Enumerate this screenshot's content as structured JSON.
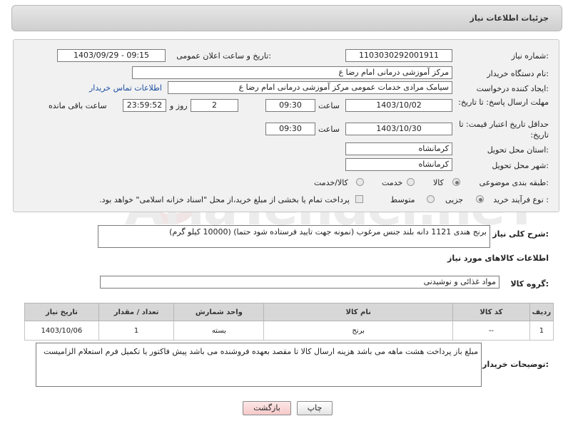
{
  "header": {
    "title": "جزئیات اطلاعات نیاز"
  },
  "watermark": "AriaTender.neT",
  "form": {
    "need_number_label": "شماره نیاز:",
    "need_number": "1103030292001911",
    "announce_label": "تاریخ و ساعت اعلان عمومی:",
    "announce_value": "1403/09/29 - 09:15",
    "buyer_org_label": "نام دستگاه خریدار:",
    "buyer_org": "مرکز آموزشی  درمانی امام رضا  ع",
    "requester_label": "ایجاد کننده درخواست:",
    "requester": "سیامک مرادی خدمات عمومی مرکز آموزشی  درمانی امام رضا  ع",
    "contact_link": "اطلاعات تماس خریدار",
    "deadline_label": "مهلت ارسال پاسخ: تا تاریخ:",
    "deadline_date": "1403/10/02",
    "time_word": "ساعت",
    "deadline_time": "09:30",
    "days_value": "2",
    "days_word": "روز و",
    "remaining_time": "23:59:52",
    "remaining_word": "ساعت باقی مانده",
    "min_price_label": "حداقل تاریخ اعتبار قیمت: تا تاریخ:",
    "min_price_date": "1403/10/30",
    "min_price_time": "09:30",
    "province_label": "استان محل تحویل:",
    "province": "کرمانشاه",
    "city_label": "شهر محل تحویل:",
    "city": "کرمانشاه",
    "category_label": "طبقه بندی موضوعی:",
    "category_options": [
      "کالا",
      "خدمت",
      "کالا/خدمت"
    ],
    "purchase_type_label": "نوع فرآیند خرید :",
    "purchase_options": [
      "جزیی",
      "متوسط"
    ],
    "payment_note": "پرداخت تمام یا بخشی از مبلغ خرید،از محل \"اسناد خزانه اسلامی\" خواهد بود."
  },
  "description": {
    "label": "شرح کلی نیاز:",
    "text": "برنج هندی 1121 دانه بلند  جنس مرغوب (نمونه جهت تایید فرستاده شود حتما)  (10000 کیلو گرم)"
  },
  "goods_info": {
    "title": "اطلاعات کالاهای مورد نیاز",
    "group_label": "گروه کالا:",
    "group_value": "مواد غذائی و نوشیدنی"
  },
  "table": {
    "headers": [
      "ردیف",
      "کد کالا",
      "نام کالا",
      "واحد شمارش",
      "تعداد / مقدار",
      "تاریخ نیاز"
    ],
    "rows": [
      [
        "1",
        "--",
        "برنج",
        "بسته",
        "1",
        "1403/10/06"
      ]
    ]
  },
  "buyer_notes": {
    "label": "توضیحات خریدار:",
    "text": "مبلغ باز پرداخت هشت ماهه می باشد هزینه ارسال کالا تا مقصد بعهده فروشنده می باشد پیش فاکتور یا تکمیل فرم استعلام الزامیست"
  },
  "buttons": {
    "print": "چاپ",
    "back": "بازگشت"
  }
}
